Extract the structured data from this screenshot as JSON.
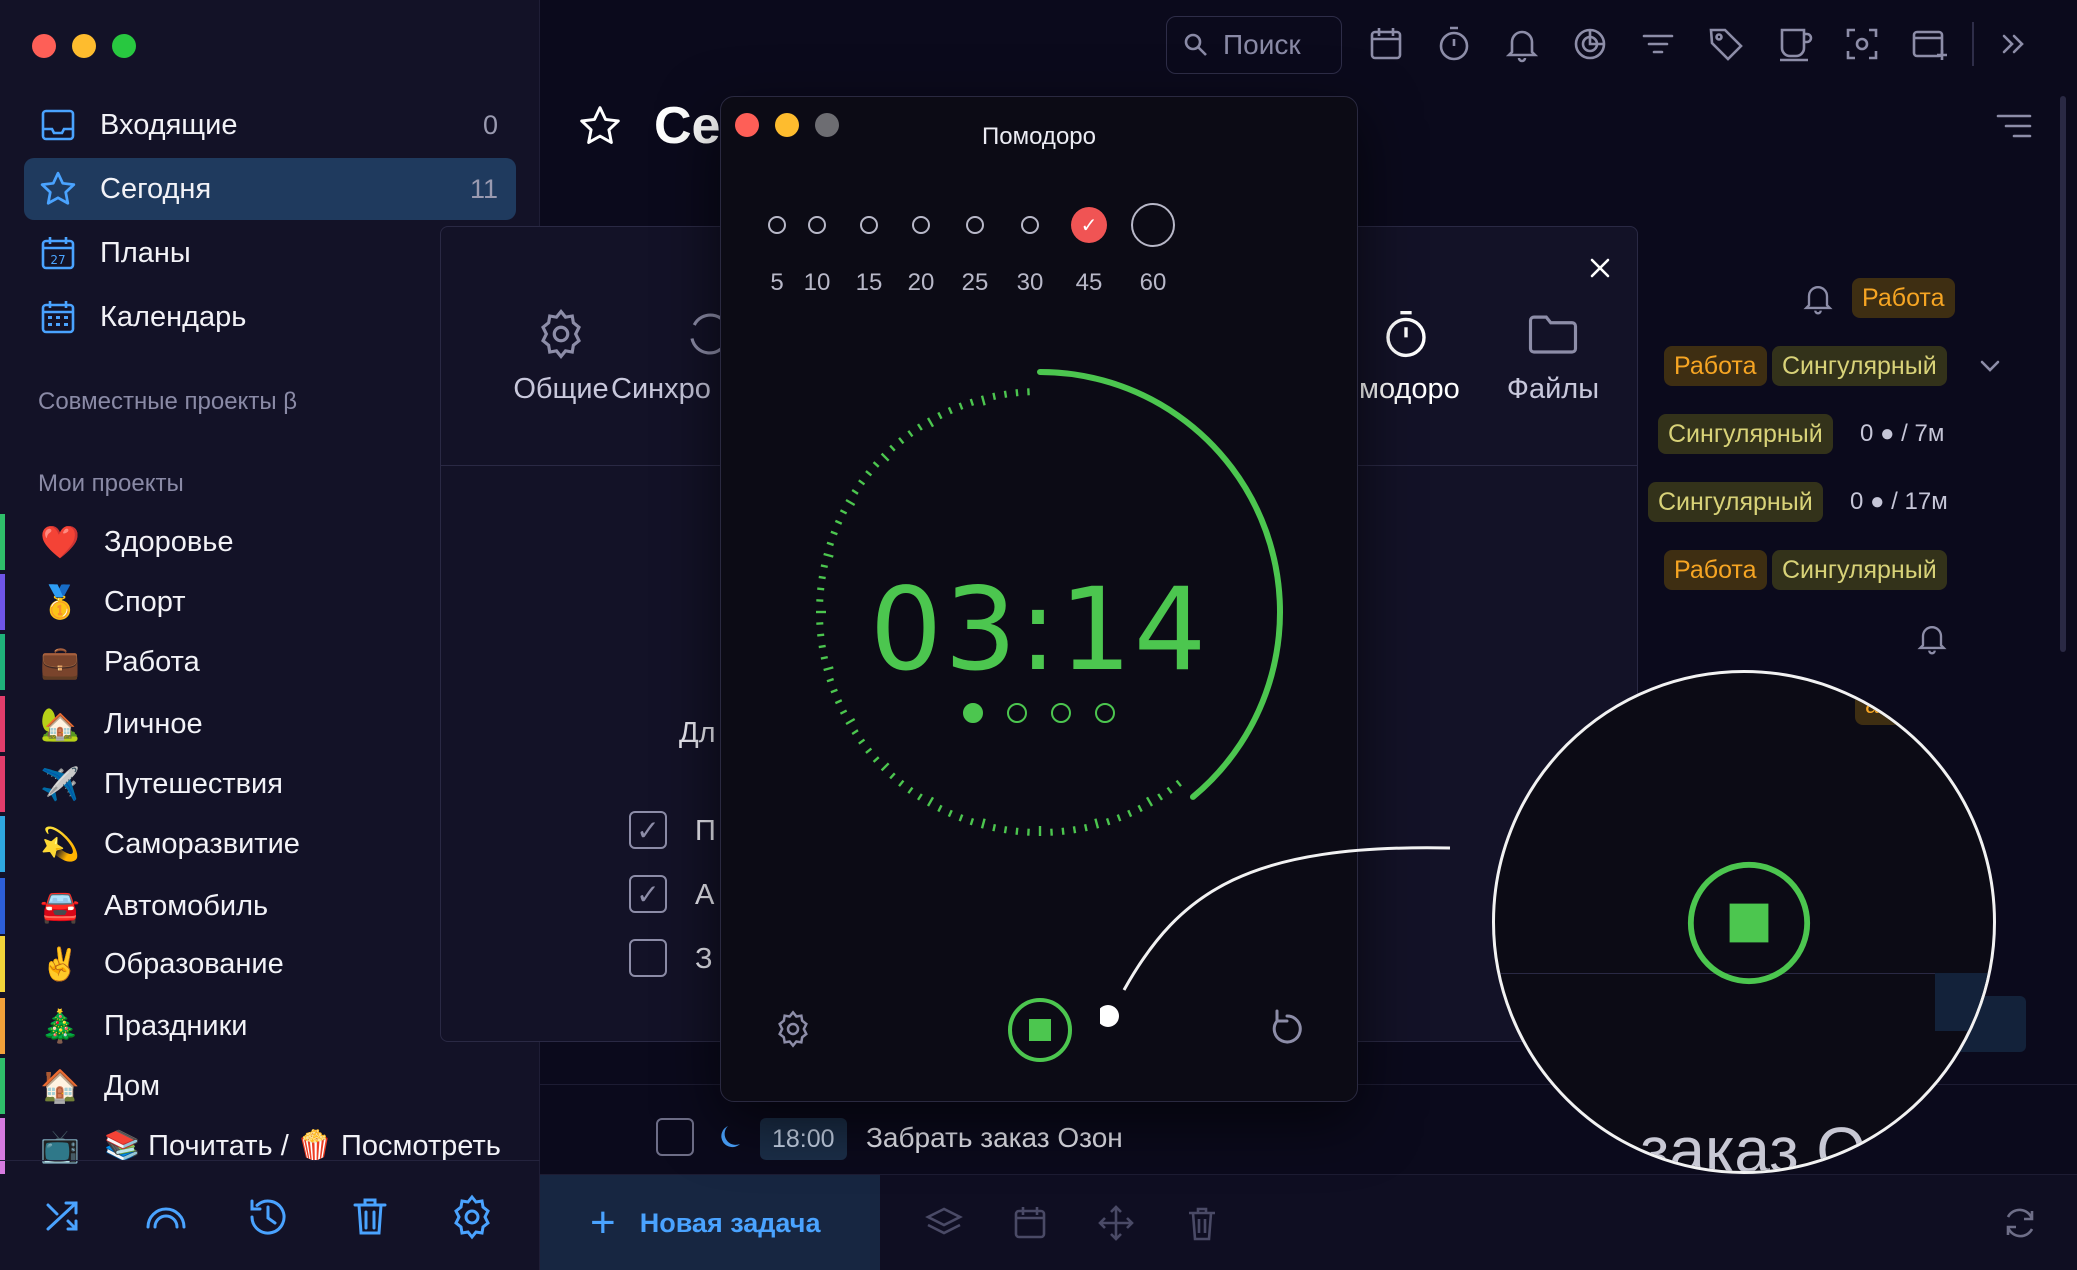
{
  "sidebar": {
    "nav": [
      {
        "label": "Входящие",
        "count": "0"
      },
      {
        "label": "Сегодня",
        "count": "11"
      },
      {
        "label": "Планы",
        "count": ""
      },
      {
        "label": "Календарь",
        "count": ""
      }
    ],
    "calendar_day": "27",
    "shared_title": "Совместные проекты β",
    "projects_title": "Мои проекты",
    "projects": [
      {
        "emoji": "❤️",
        "label": "Здоровье",
        "color": "#2fbf6a"
      },
      {
        "emoji": "🥇",
        "label": "Спорт",
        "color": "#6f55e8"
      },
      {
        "emoji": "💼",
        "label": "Работа",
        "color": "#1fb27a"
      },
      {
        "emoji": "🏡",
        "label": "Личное",
        "color": "#e23d6b"
      },
      {
        "emoji": "✈️",
        "label": "Путешествия",
        "color": "#e23d6b"
      },
      {
        "emoji": "💫",
        "label": "Саморазвитие",
        "color": "#2fa7e0"
      },
      {
        "emoji": "🚘",
        "label": "Автомобиль",
        "color": "#2d5fd8"
      },
      {
        "emoji": "✌️",
        "label": "Образование",
        "color": "#f2d43a"
      },
      {
        "emoji": "🎄",
        "label": "Праздники",
        "color": "#f2a13a"
      },
      {
        "emoji": "🏠",
        "label": "Дом",
        "color": "#2fbf6a"
      },
      {
        "emoji": "📺",
        "label": "📚 Почитать / 🍿 Посмотреть",
        "color": "#d67be0"
      }
    ]
  },
  "topbar": {
    "search_placeholder": "Поиск"
  },
  "main": {
    "title": "Се"
  },
  "settings": {
    "tabs": [
      "Общие",
      "Синхро",
      "модоро",
      "Файлы"
    ],
    "label_partial": "Дл",
    "options": [
      {
        "label": "П",
        "checked": true
      },
      {
        "label": "А",
        "checked": true
      },
      {
        "label": "З",
        "checked": false
      }
    ]
  },
  "tags": {
    "work": "Работа",
    "singular": "Сингулярный",
    "meta1": "0 ● / 7м",
    "meta2": "0 ● / 17м",
    "work_partial": "абота"
  },
  "pomodoro": {
    "title": "Помодоро",
    "durations": [
      "5",
      "10",
      "15",
      "20",
      "25",
      "30",
      "45",
      "60"
    ],
    "selected_duration": "45",
    "time": "03:14",
    "progress_fraction": 0.39,
    "sessions": {
      "done": 1,
      "total": 4
    },
    "accent": "#4cc64f"
  },
  "task": {
    "time": "18:00",
    "title": "Забрать заказ Озон"
  },
  "footer": {
    "new_task": "Новая задача"
  },
  "magnifier": {
    "text": "заказ Оз"
  }
}
